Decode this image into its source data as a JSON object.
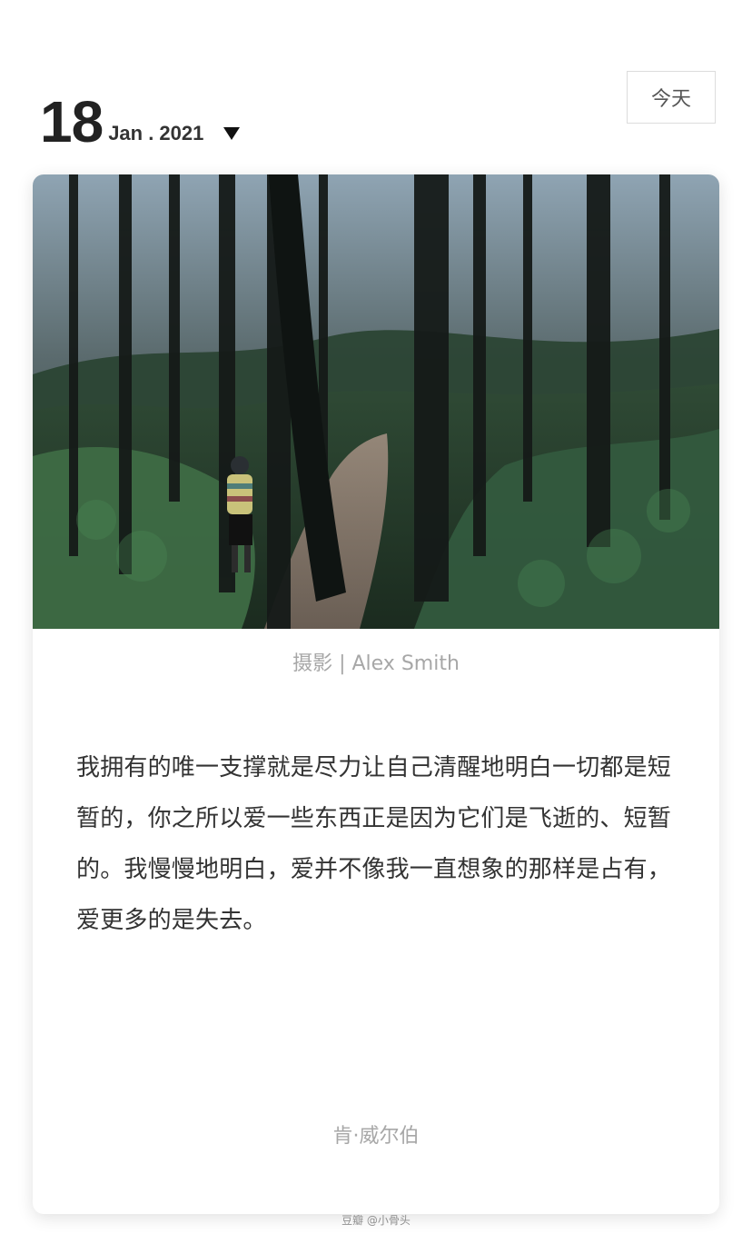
{
  "header": {
    "day": "18",
    "month_year": "Jan . 2021",
    "today_label": "今天"
  },
  "card": {
    "photo_alt": "Child standing on a forest trail among tall trees",
    "credit": "摄影 | Alex Smith",
    "quote": "我拥有的唯一支撑就是尽力让自己清醒地明白一切都是短暂的，你之所以爱一些东西正是因为它们是飞逝的、短暂的。我慢慢地明白，爱并不像我一直想象的那样是占有，爱更多的是失去。",
    "author": "肯·威尔伯"
  },
  "watermark": "豆瓣 @小骨头",
  "icons": {
    "dropdown": "caret-down-icon"
  },
  "colors": {
    "text_primary": "#333333",
    "text_muted": "#a7a7a7",
    "border": "#dcdcdc"
  }
}
